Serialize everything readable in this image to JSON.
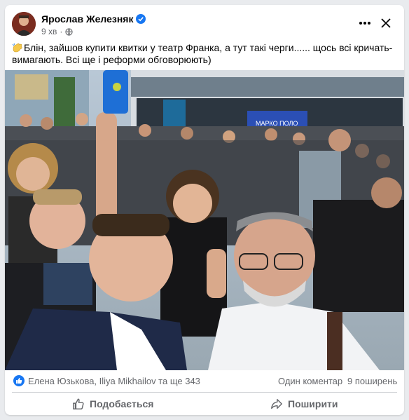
{
  "post": {
    "author": "Ярослав Железняк",
    "time": "9 хв",
    "separator": "·",
    "text": "Блін, зайшов купити квитки у театр Франка, а тут такі черги...... щось всі кричать-вимагають. Всі ще і реформи обговорюють)"
  },
  "photo": {
    "sign_text": "МАРКО ПОЛО"
  },
  "stats": {
    "reactors": "Елена Юзькова, Iliya Mikhailov та ще 343",
    "comments": "Один коментар",
    "shares": "9 поширень"
  },
  "actions": {
    "like_label": "Подобається",
    "share_label": "Поширити"
  },
  "icons": {
    "verified": "verified-badge-icon",
    "globe": "globe-icon",
    "more": "more-options-icon",
    "close": "close-icon",
    "like_reaction": "like-reaction-icon",
    "like_action": "thumbs-up-icon",
    "share_action": "share-arrow-icon"
  },
  "colors": {
    "brand": "#1877f2",
    "text_secondary": "#65676b"
  }
}
